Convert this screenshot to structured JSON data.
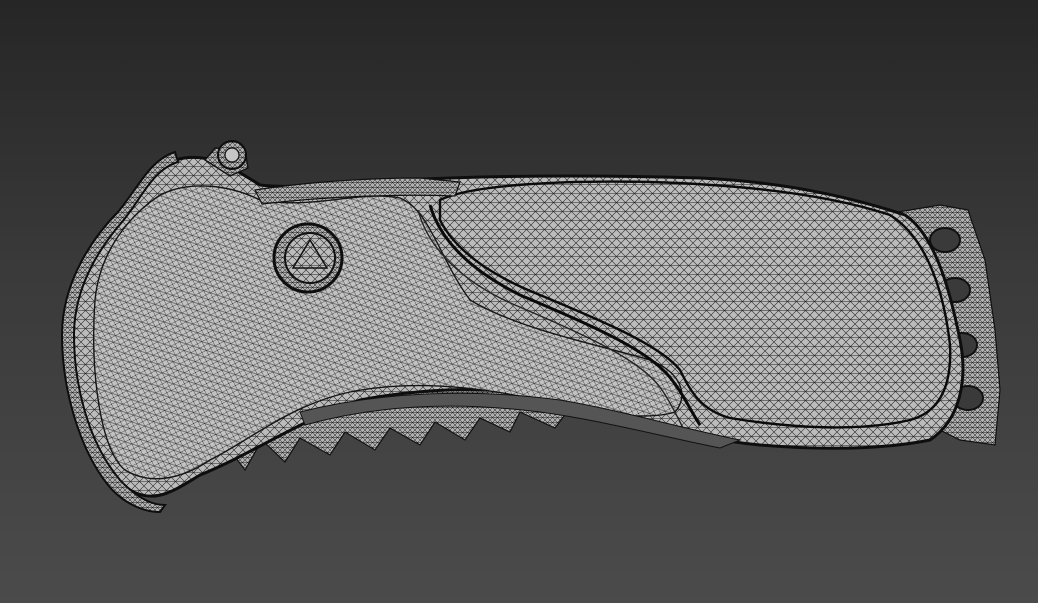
{
  "viewport": {
    "background_top": "#262626",
    "background_bottom": "#4b4b4b",
    "mesh_fill": "#b9b9b9",
    "mesh_wire": "#1e1e1e",
    "render_mode": "wireframe-on-shaded"
  },
  "model": {
    "icon": "folding-knife-handle-mesh-icon"
  }
}
